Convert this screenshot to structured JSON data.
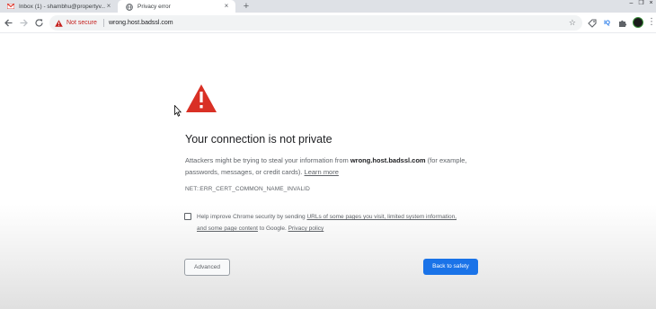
{
  "tabs": [
    {
      "title": "Inbox (1) - shambhu@propertyv...",
      "icon": "gmail-icon",
      "active": false
    },
    {
      "title": "Privacy error",
      "icon": "globe-icon",
      "active": true
    }
  ],
  "toolbar": {
    "security_label": "Not secure",
    "url": "wrong.host.badssl.com",
    "extensions": [
      "tag-icon",
      "IQ",
      "puzzle-icon"
    ],
    "warning_color": "#c5221f"
  },
  "page": {
    "heading": "Your connection is not private",
    "desc_prefix": "Attackers might be trying to steal your information from ",
    "desc_host": "wrong.host.badssl.com",
    "desc_suffix": " (for example, passwords, messages, or credit cards). ",
    "learn_more": "Learn more",
    "error_code": "NET::ERR_CERT_COMMON_NAME_INVALID",
    "help_prefix": "Help improve Chrome security by sending ",
    "help_link": "URLs of some pages you visit, limited system information, and some page content",
    "help_middle": " to Google. ",
    "privacy_link": "Privacy policy",
    "advanced_label": "Advanced",
    "back_label": "Back to safety",
    "accent_color": "#1a73e8",
    "icon_color": "#d93025"
  }
}
